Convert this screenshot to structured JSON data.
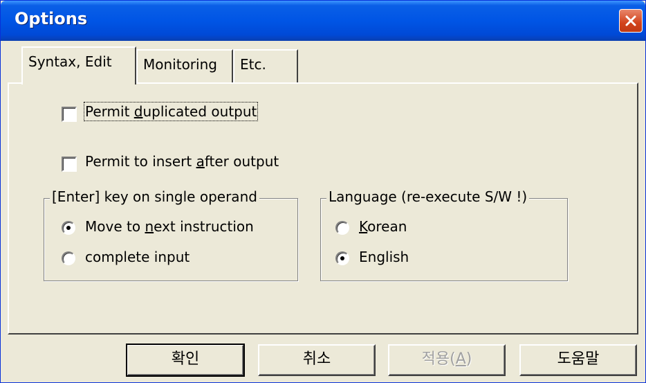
{
  "window": {
    "title": "Options"
  },
  "tabs": [
    {
      "label": "Syntax, Edit",
      "active": true
    },
    {
      "label": "Monitoring",
      "active": false
    },
    {
      "label": "Etc.",
      "active": false
    }
  ],
  "options": {
    "permit_duplicated": {
      "pre": "Permit ",
      "key": "d",
      "post": "uplicated output",
      "checked": false
    },
    "permit_insert": {
      "pre": "Permit to insert ",
      "key": "a",
      "post": "fter output",
      "checked": false
    }
  },
  "enter_group": {
    "title": "[Enter] key on single operand",
    "move_next": {
      "pre": "Move to ",
      "key": "n",
      "post": "ext instruction",
      "checked": true
    },
    "complete_input": {
      "label": "complete input",
      "checked": false
    }
  },
  "language_group": {
    "title": "Language (re-execute S/W !)",
    "korean": {
      "pre": "",
      "key": "K",
      "post": "orean",
      "checked": false
    },
    "english": {
      "label": "English",
      "checked": true
    }
  },
  "buttons": {
    "ok": "확인",
    "cancel": "취소",
    "apply_pre": "적용(",
    "apply_key": "A",
    "apply_post": ")",
    "help": "도움말"
  }
}
